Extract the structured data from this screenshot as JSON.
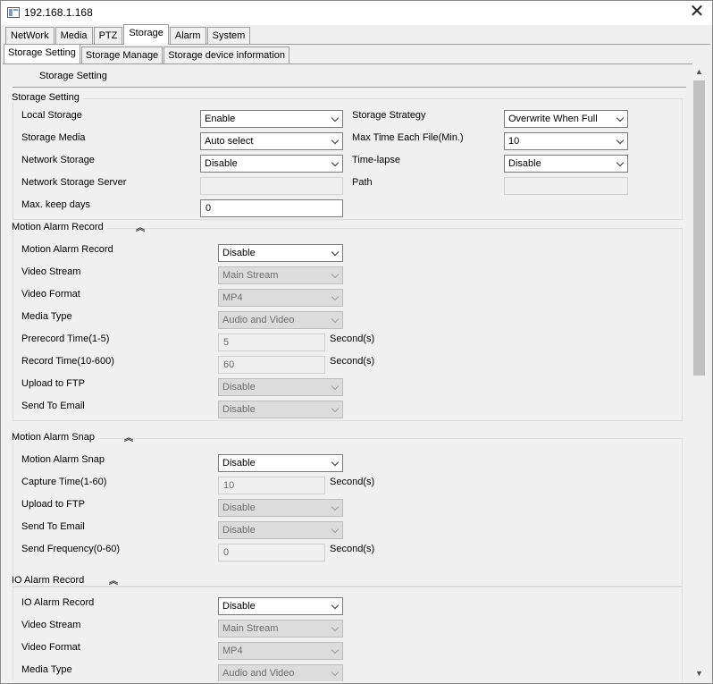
{
  "window": {
    "title": "192.168.1.168"
  },
  "tabs": [
    "NetWork",
    "Media",
    "PTZ",
    "Storage",
    "Alarm",
    "System"
  ],
  "active_tab": "Storage",
  "subtabs": [
    "Storage Setting",
    "Storage Manage",
    "Storage device information"
  ],
  "active_subtab": "Storage Setting",
  "header": "Storage Setting",
  "storage_setting": {
    "title": "Storage Setting",
    "local_storage": {
      "label": "Local Storage",
      "value": "Enable"
    },
    "storage_strategy": {
      "label": "Storage Strategy",
      "value": "Overwrite When Full"
    },
    "storage_media": {
      "label": "Storage Media",
      "value": "Auto select"
    },
    "max_time_each_file": {
      "label": "Max Time Each File(Min.)",
      "value": "10"
    },
    "network_storage": {
      "label": "Network Storage",
      "value": "Disable"
    },
    "time_lapse": {
      "label": "Time-lapse",
      "value": "Disable"
    },
    "network_storage_server": {
      "label": "Network Storage Server",
      "value": ""
    },
    "path": {
      "label": "Path",
      "value": ""
    },
    "max_keep_days": {
      "label": "Max. keep days",
      "value": "0"
    }
  },
  "motion_alarm_record": {
    "title": "Motion Alarm Record",
    "record": {
      "label": "Motion Alarm Record",
      "value": "Disable"
    },
    "video_stream": {
      "label": "Video Stream",
      "value": "Main Stream"
    },
    "video_format": {
      "label": "Video Format",
      "value": "MP4"
    },
    "media_type": {
      "label": "Media Type",
      "value": "Audio and Video"
    },
    "prerecord_time": {
      "label": "Prerecord Time(1-5)",
      "value": "5",
      "unit": "Second(s)"
    },
    "record_time": {
      "label": "Record Time(10-600)",
      "value": "60",
      "unit": "Second(s)"
    },
    "upload_ftp": {
      "label": "Upload to FTP",
      "value": "Disable"
    },
    "send_email": {
      "label": "Send To Email",
      "value": "Disable"
    }
  },
  "motion_alarm_snap": {
    "title": "Motion Alarm Snap",
    "snap": {
      "label": "Motion Alarm Snap",
      "value": "Disable"
    },
    "capture_time": {
      "label": "Capture Time(1-60)",
      "value": "10",
      "unit": "Second(s)"
    },
    "upload_ftp": {
      "label": "Upload to FTP",
      "value": "Disable"
    },
    "send_email": {
      "label": "Send To Email",
      "value": "Disable"
    },
    "send_frequency": {
      "label": "Send Frequency(0-60)",
      "value": "0",
      "unit": "Second(s)"
    }
  },
  "io_alarm_record": {
    "title": "IO Alarm Record",
    "record": {
      "label": "IO Alarm Record",
      "value": "Disable"
    },
    "video_stream": {
      "label": "Video Stream",
      "value": "Main Stream"
    },
    "video_format": {
      "label": "Video Format",
      "value": "MP4"
    },
    "media_type": {
      "label": "Media Type",
      "value": "Audio and Video"
    }
  }
}
